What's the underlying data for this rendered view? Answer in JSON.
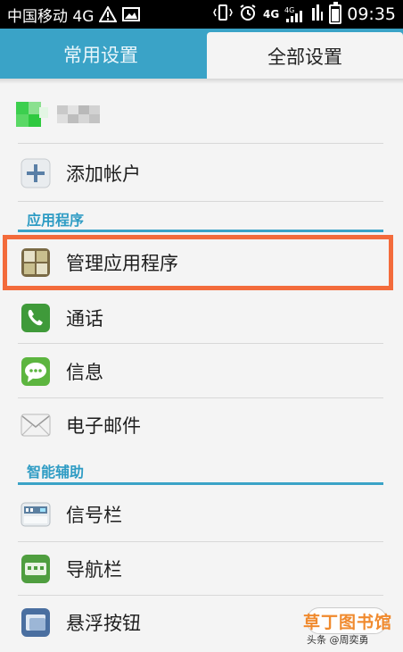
{
  "status_bar": {
    "carrier": "中国移动 4G",
    "net1": "4G",
    "net2": "4G",
    "time": "09:35"
  },
  "tabs": [
    {
      "label": "常用设置",
      "active": false
    },
    {
      "label": "全部设置",
      "active": true
    }
  ],
  "account": {
    "name_blurred": true
  },
  "items": {
    "add_account": "添加帐户",
    "section_apps": "应用程序",
    "manage_apps": "管理应用程序",
    "calls": "通话",
    "messages": "信息",
    "email": "电子邮件",
    "section_smart": "智能辅助",
    "signal_bar": "信号栏",
    "nav_bar": "导航栏",
    "floating_button": "悬浮按钮"
  },
  "watermark": {
    "line1": "草丁图书馆",
    "line2": "头条 @周奕勇"
  },
  "colors": {
    "accent": "#3aa3c7",
    "highlight": "#f36b3b",
    "section_text": "#2f9cc4"
  }
}
